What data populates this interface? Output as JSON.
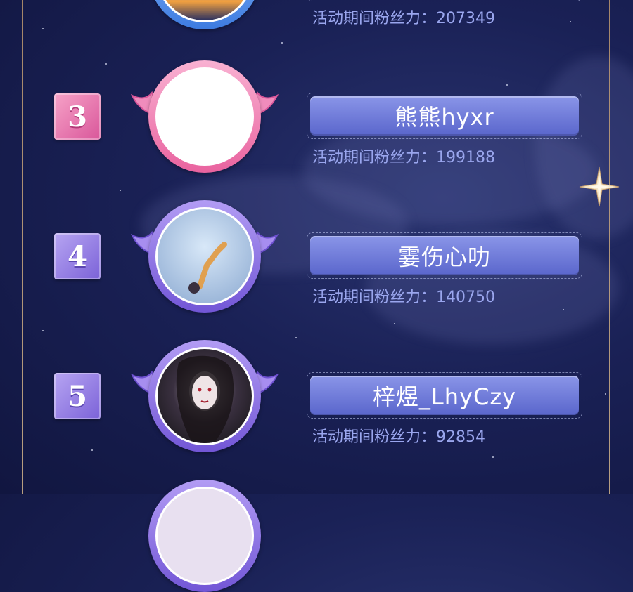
{
  "fans_label": "活动期间粉丝力：",
  "entries": [
    {
      "rank": "",
      "name": "",
      "fans": "207349"
    },
    {
      "rank": "3",
      "name": "熊熊hyxr",
      "fans": "199188"
    },
    {
      "rank": "4",
      "name": "霎伤心叻",
      "fans": "140750"
    },
    {
      "rank": "5",
      "name": "梓煜_LhyCzy",
      "fans": "92854"
    }
  ],
  "colors": {
    "pink": "#e9639f",
    "purple": "#7256d6",
    "pill": "#6f7bdc",
    "fans_text": "#9aa6ee"
  },
  "icons": [
    "wing-icon",
    "sparkle-star-icon"
  ]
}
